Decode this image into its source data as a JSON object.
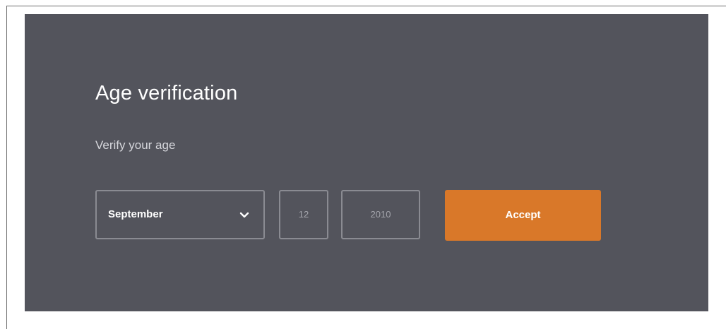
{
  "dialog": {
    "title": "Age verification",
    "subtitle": "Verify your age"
  },
  "form": {
    "month": {
      "selected": "September",
      "icon": "chevron-down-icon"
    },
    "day": {
      "value": "12"
    },
    "year": {
      "value": "2010"
    },
    "accept_label": "Accept"
  },
  "colors": {
    "panel_background": "#53545c",
    "field_border": "#8a8b92",
    "accent": "#d97829",
    "text_primary": "#ffffff",
    "text_secondary": "#d6d7dc",
    "field_text": "#a5a6ad"
  }
}
